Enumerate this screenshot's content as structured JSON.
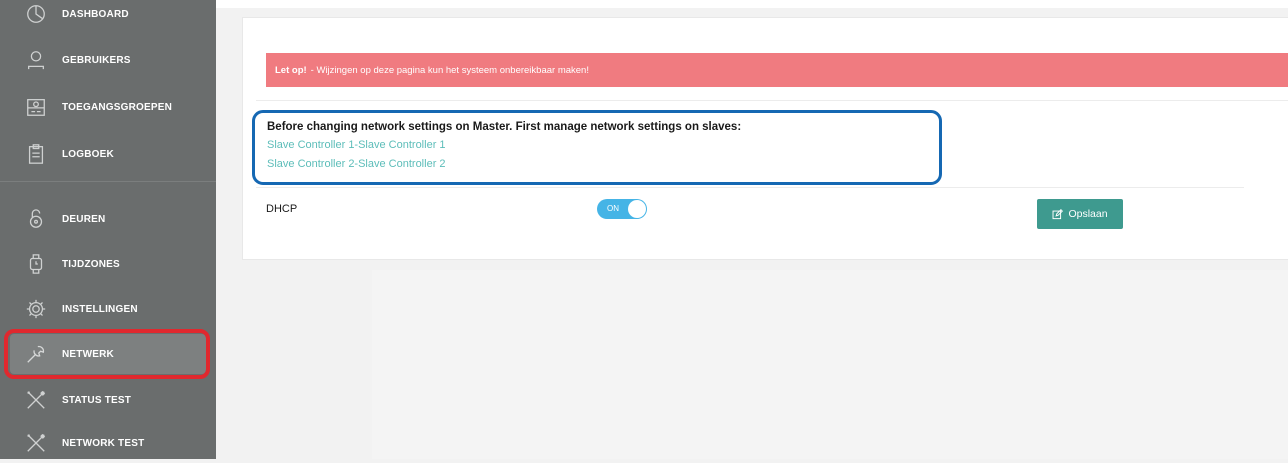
{
  "sidebar": {
    "items": [
      {
        "label": "DASHBOARD",
        "icon": "pie-chart-icon"
      },
      {
        "label": "GEBRUIKERS",
        "icon": "user-icon"
      },
      {
        "label": "TOEGANGSGROEPEN",
        "icon": "group-card-icon"
      },
      {
        "label": "LOGBOEK",
        "icon": "clipboard-icon"
      },
      {
        "label": "DEUREN",
        "icon": "lock-icon"
      },
      {
        "label": "TIJDZONES",
        "icon": "watch-icon"
      },
      {
        "label": "INSTELLINGEN",
        "icon": "gear-icon"
      },
      {
        "label": "NETWERK",
        "icon": "wrench-icon"
      },
      {
        "label": "STATUS TEST",
        "icon": "tools-icon"
      },
      {
        "label": "NETWORK TEST",
        "icon": "tools-icon"
      }
    ],
    "active": "NETWERK"
  },
  "alert": {
    "strong": "Let op!",
    "text": "- Wijzingen op deze pagina kun het systeem onbereikbaar maken!"
  },
  "info": {
    "title": "Before changing network settings on Master. First manage network settings on slaves:",
    "links": [
      "Slave Controller 1-Slave Controller 1",
      "Slave Controller 2-Slave Controller 2"
    ]
  },
  "dhcp": {
    "label": "DHCP",
    "toggle_text": "ON",
    "enabled": true
  },
  "save_button": {
    "label": "Opslaan",
    "icon": "edit-icon"
  },
  "colors": {
    "sidebar_bg": "#6a6d6d",
    "alert_bg": "#f07b80",
    "link": "#5cbdb9",
    "toggle": "#45b4e6",
    "save_button": "#3e9a8f",
    "highlight_blue": "#1568b3",
    "highlight_red": "#e0282e"
  }
}
